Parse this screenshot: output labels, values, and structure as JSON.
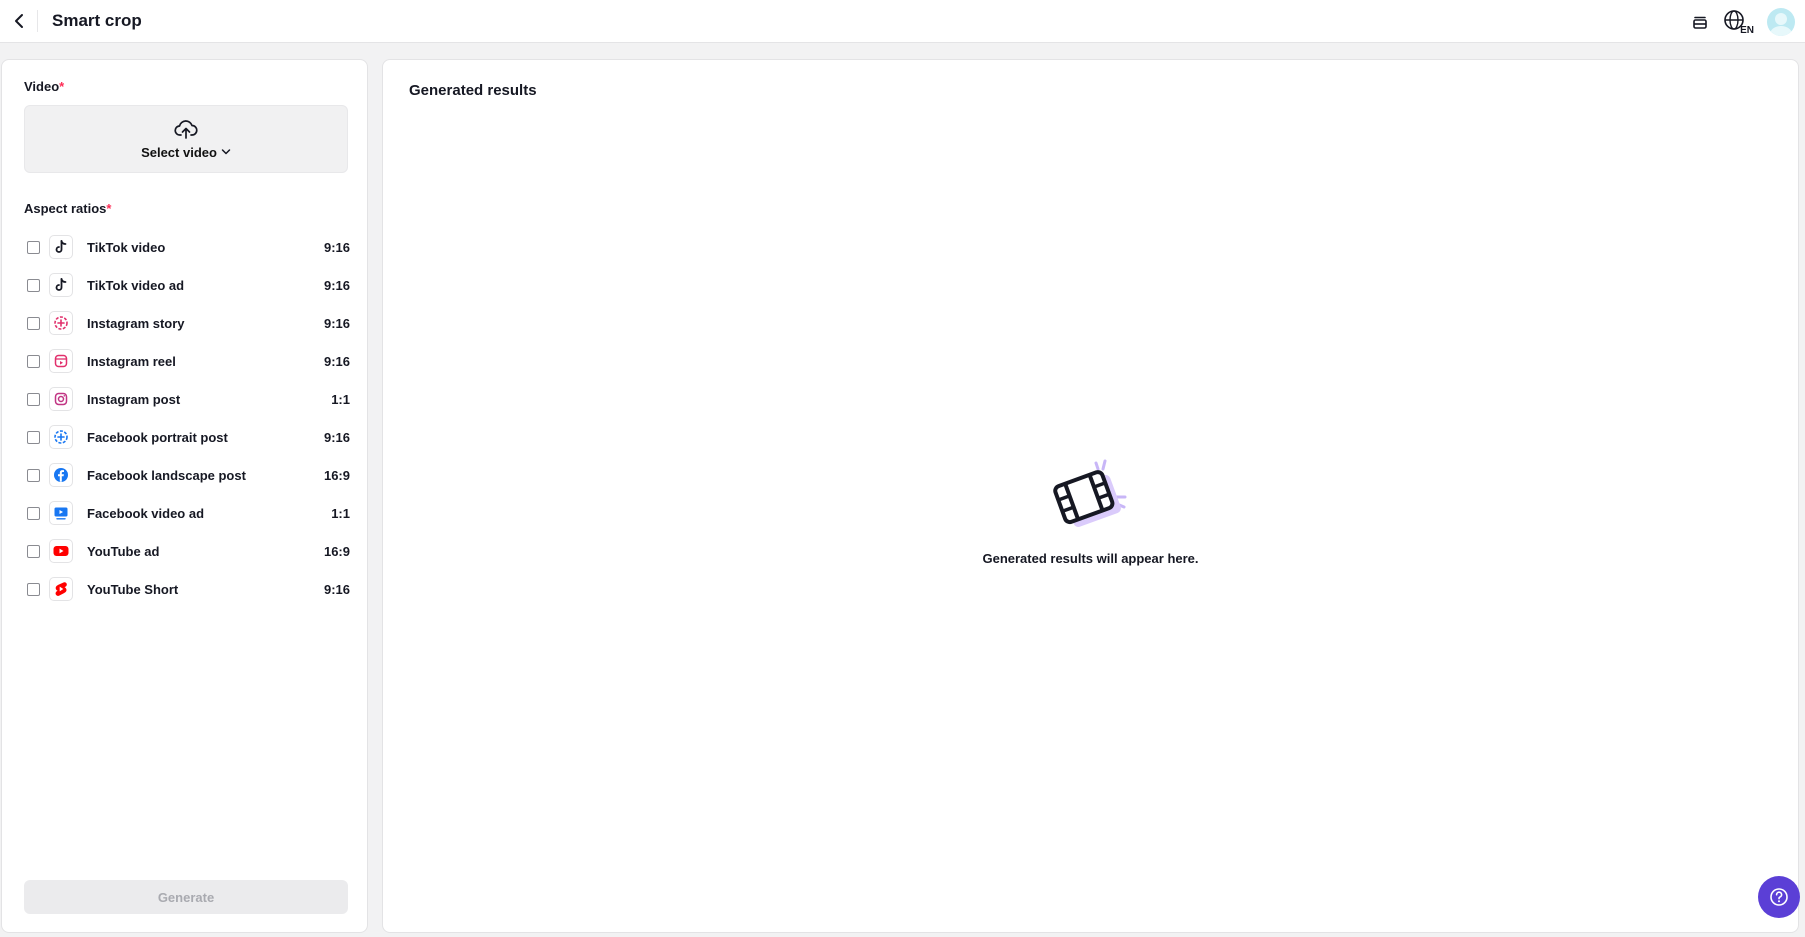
{
  "header": {
    "title": "Smart crop",
    "language_code": "EN"
  },
  "video_section": {
    "label": "Video",
    "required_mark": "*",
    "select_label": "Select video"
  },
  "aspect_section": {
    "label": "Aspect ratios",
    "required_mark": "*",
    "items": [
      {
        "label": "TikTok video",
        "ratio": "9:16",
        "icon": "tiktok-icon"
      },
      {
        "label": "TikTok video ad",
        "ratio": "9:16",
        "icon": "tiktok-icon"
      },
      {
        "label": "Instagram story",
        "ratio": "9:16",
        "icon": "instagram-story-icon"
      },
      {
        "label": "Instagram reel",
        "ratio": "9:16",
        "icon": "instagram-reel-icon"
      },
      {
        "label": "Instagram post",
        "ratio": "1:1",
        "icon": "instagram-icon"
      },
      {
        "label": "Facebook portrait post",
        "ratio": "9:16",
        "icon": "facebook-story-icon"
      },
      {
        "label": "Facebook landscape post",
        "ratio": "16:9",
        "icon": "facebook-icon"
      },
      {
        "label": "Facebook video ad",
        "ratio": "1:1",
        "icon": "facebook-video-icon"
      },
      {
        "label": "YouTube ad",
        "ratio": "16:9",
        "icon": "youtube-icon"
      },
      {
        "label": "YouTube Short",
        "ratio": "9:16",
        "icon": "youtube-shorts-icon"
      }
    ]
  },
  "generate_label": "Generate",
  "results": {
    "title": "Generated results",
    "empty_message": "Generated results will appear here."
  },
  "colors": {
    "accent": "#5b3fd6",
    "required": "#fe2c55"
  }
}
